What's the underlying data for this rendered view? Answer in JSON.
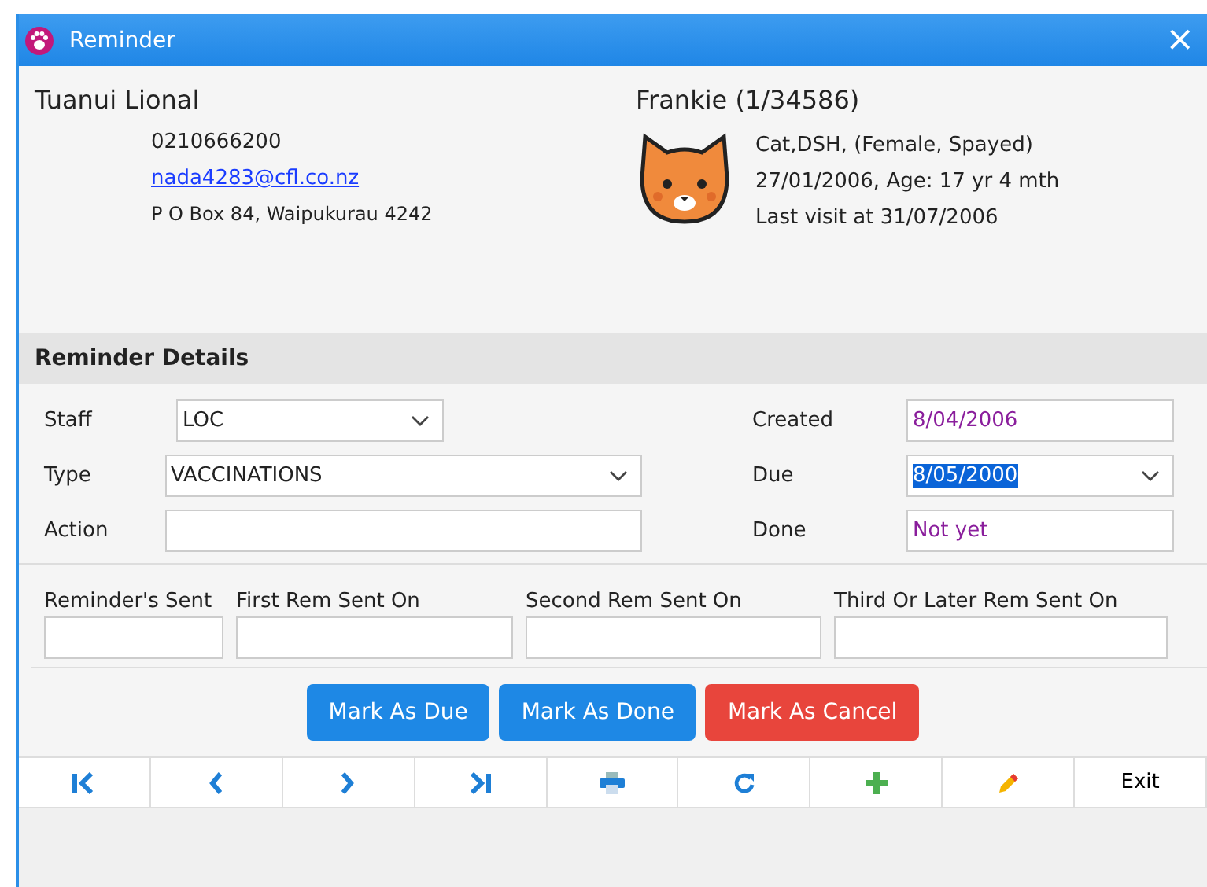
{
  "window": {
    "title": "Reminder",
    "close": "×"
  },
  "owner": {
    "name": "Tuanui Lional",
    "phone": "0210666200",
    "email": "nada4283@cfl.co.nz",
    "address": "P O Box 84, Waipukurau 4242"
  },
  "patient": {
    "name": "Frankie (1/34586)",
    "lines": [
      "Cat,DSH, (Female, Spayed)",
      "27/01/2006, Age: 17 yr 4 mth",
      "Last visit at 31/07/2006"
    ]
  },
  "section": {
    "title": "Reminder Details"
  },
  "left_fields": [
    {
      "label": "Staff",
      "value": "LOC",
      "kind": "dropdown"
    },
    {
      "label": "Type",
      "value": "VACCINATIONS",
      "kind": "dropdown"
    },
    {
      "label": "Action",
      "kind": "text"
    }
  ],
  "right_fields": [
    {
      "label": "Created",
      "value": "8/04/2006",
      "kind": "text",
      "highlighted": false
    },
    {
      "label": "Due",
      "value": "8/05/2000",
      "kind": "dropdown",
      "highlighted": true
    },
    {
      "label": "Done",
      "value": "Not yet",
      "kind": "text",
      "highlighted": false
    }
  ],
  "sent_fields": [
    {
      "label": "Reminder's Sent"
    },
    {
      "label": "First Rem Sent On"
    },
    {
      "label": "Second Rem Sent On"
    },
    {
      "label": "Third Or Later Rem Sent On"
    }
  ],
  "actions": [
    {
      "label": "Mark As Due",
      "kind": "primary"
    },
    {
      "label": "Mark As Done",
      "kind": "primary"
    },
    {
      "label": "Mark As Cancel",
      "kind": "danger"
    }
  ],
  "toolbar": [
    {
      "kind": "first"
    },
    {
      "kind": "previous"
    },
    {
      "kind": "next"
    },
    {
      "kind": "last"
    },
    {
      "kind": "print"
    },
    {
      "kind": "refresh"
    },
    {
      "kind": "add"
    },
    {
      "kind": "edit"
    },
    {
      "kind": "text",
      "label": "Exit"
    }
  ]
}
